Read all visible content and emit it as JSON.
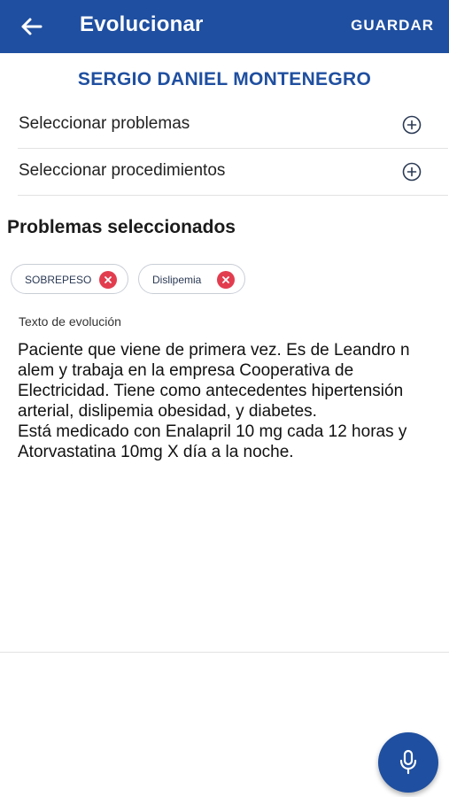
{
  "appbar": {
    "title": "Evolucionar",
    "back_icon": "arrow-left-icon",
    "save_label": "GUARDAR",
    "background_color": "#1f4fa0"
  },
  "patient": {
    "name": "SERGIO DANIEL MONTENEGRO"
  },
  "options": [
    {
      "label": "Seleccionar problemas",
      "icon": "add-circle-icon"
    },
    {
      "label": "Seleccionar procedimientos",
      "icon": "add-circle-icon"
    }
  ],
  "selected_problems": {
    "title": "Problemas seleccionados",
    "chips": [
      {
        "label": "SOBREPESO",
        "remove_icon": "close-icon"
      },
      {
        "label": "Dislipemia",
        "remove_icon": "close-icon"
      }
    ]
  },
  "evolution": {
    "label": "Texto de evolución",
    "text": "Paciente que viene de primera vez. Es de Leandro n alem y trabaja en la empresa Cooperativa de Electricidad. Tiene como antecedentes hipertensión arterial, dislipemia obesidad, y diabetes.\nEstá medicado con Enalapril 10 mg cada 12 horas y Atorvastatina 10mg X día a la noche."
  },
  "fab": {
    "icon": "microphone-icon"
  },
  "colors": {
    "primary": "#1f4fa0",
    "chip_remove": "#e23d4f"
  }
}
